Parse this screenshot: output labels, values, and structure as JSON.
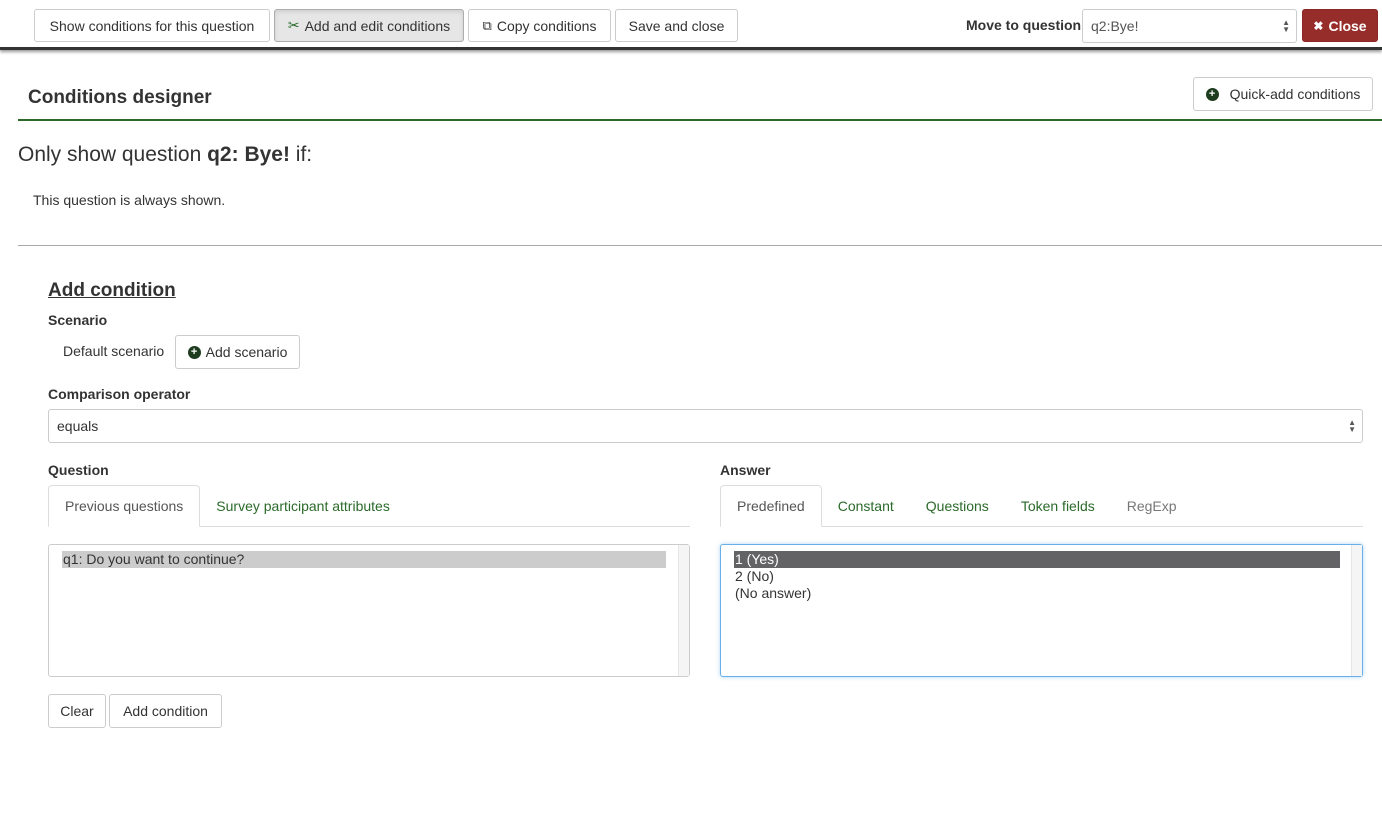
{
  "toolbar": {
    "show_conditions": "Show conditions for this question",
    "add_edit_conditions": "Add and edit conditions",
    "copy_conditions": "Copy conditions",
    "save_close": "Save and close",
    "move_to_label": "Move to question:",
    "move_to_value": "q2:Bye!",
    "close": "Close"
  },
  "header": {
    "title": "Conditions designer",
    "quick_add": "Quick-add conditions"
  },
  "summary": {
    "prefix": "Only show question ",
    "question": "q2: Bye!",
    "suffix": " if:",
    "status": "This question is always shown."
  },
  "add_condition": {
    "title": "Add condition",
    "scenario_label": "Scenario",
    "scenario_value": "Default scenario",
    "add_scenario": "Add scenario",
    "operator_label": "Comparison operator",
    "operator_value": "equals",
    "question_label": "Question",
    "question_tabs": [
      "Previous questions",
      "Survey participant attributes"
    ],
    "question_options": [
      "q1: Do you want to continue?"
    ],
    "answer_label": "Answer",
    "answer_tabs": [
      "Predefined",
      "Constant",
      "Questions",
      "Token fields",
      "RegExp"
    ],
    "answer_options": [
      "1 (Yes)",
      "2 (No)",
      "(No answer)"
    ],
    "clear": "Clear",
    "submit": "Add condition"
  },
  "colors": {
    "accent": "#2a6a2a",
    "danger": "#962d2a",
    "selected": "#636366"
  }
}
